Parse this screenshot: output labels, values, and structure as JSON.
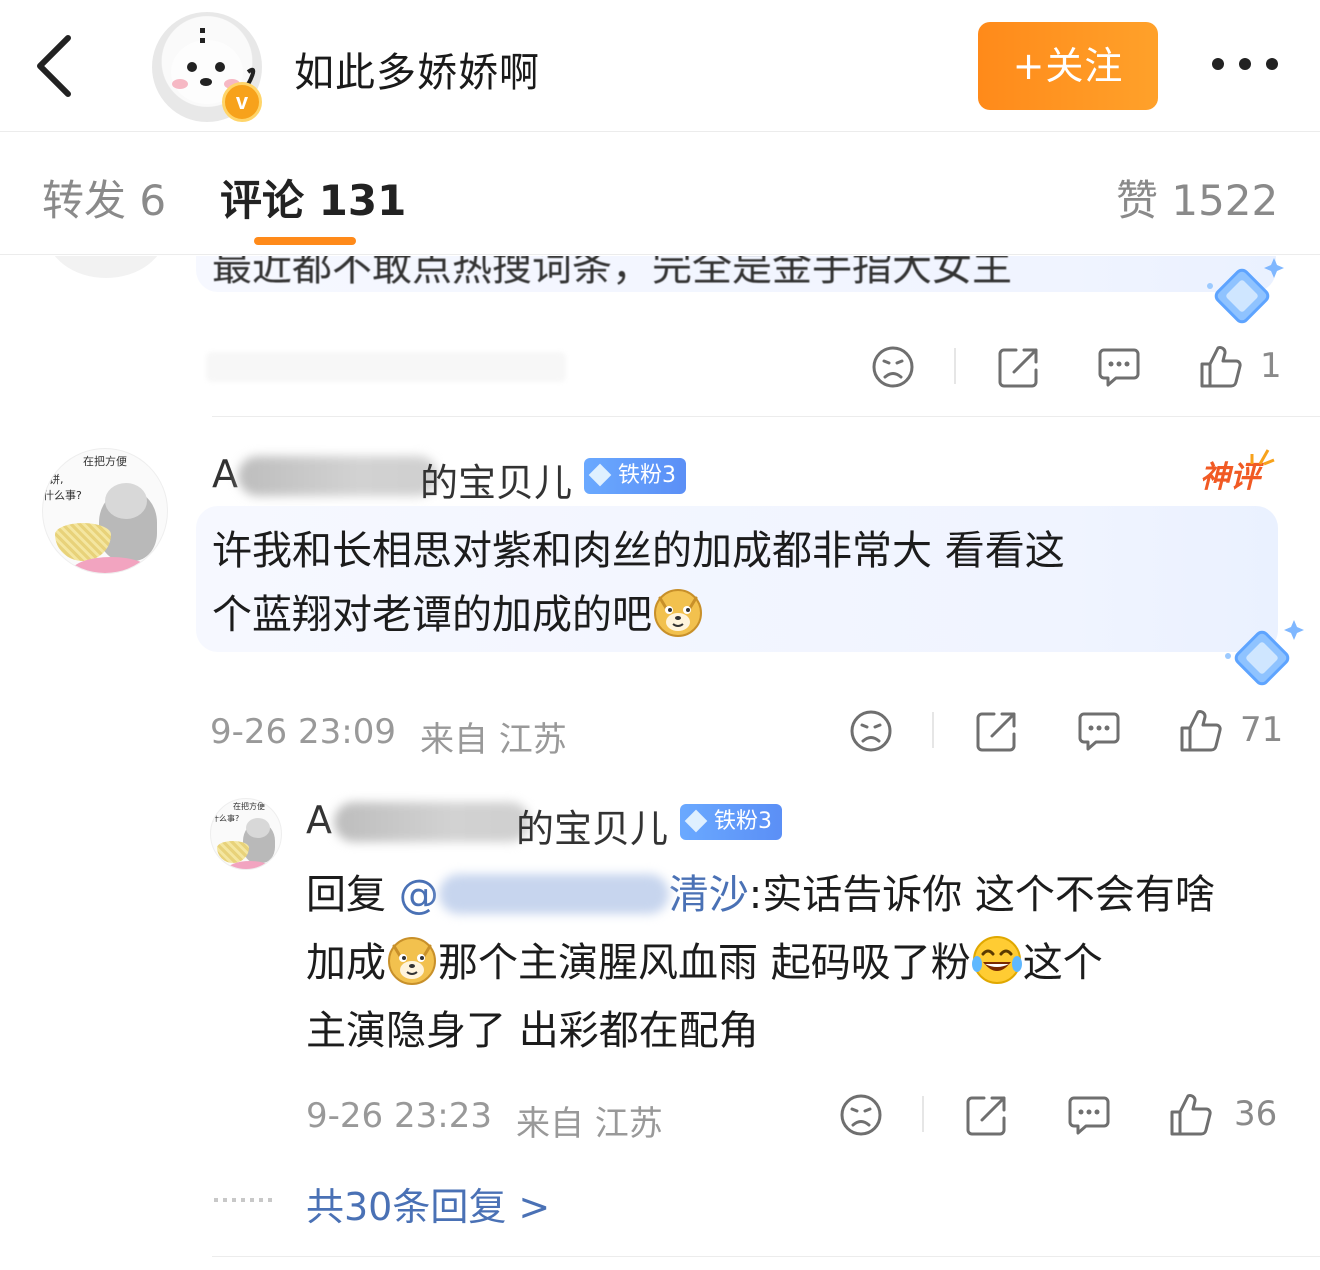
{
  "header": {
    "title": "如此多娇娇啊",
    "verified_badge": "v",
    "follow_label": "+关注"
  },
  "tabs": {
    "repost": "转发 6",
    "comments": "评论 131",
    "likes": "赞 1522"
  },
  "previous_comment": {
    "text_partial": "最近都不敢点热搜词条，完全是金手指大女主",
    "like_count": "1"
  },
  "comment": {
    "username_visible_start": "A",
    "username_visible_end": "的宝贝儿",
    "fan_badge": "铁粉3",
    "god_label": "神评",
    "text_line1": "许我和长相思对紫和肉丝的加成都非常大  看看这",
    "text_line2": "个蓝翔对老谭的加成的吧",
    "timestamp": "9-26 23:09",
    "location": "来自 江苏",
    "like_count": "71",
    "avatar_text_top": "在把方便",
    "avatar_text_left1": "饼,",
    "avatar_text_left2": "什么事?"
  },
  "reply": {
    "username_visible_start": "A",
    "username_visible_end": "的宝贝儿",
    "fan_badge": "铁粉3",
    "reply_prefix": "回复 ",
    "mention_start": "@",
    "mention_end": "清沙",
    "text_after_mention": ":实话告诉你 这个不会有啥",
    "line2_part1": "加成",
    "line2_part2": "那个主演腥风血雨 起码吸了粉",
    "line2_part3": "这个",
    "line3": "主演隐身了  出彩都在配角",
    "timestamp": "9-26 23:23",
    "location": "来自 江苏",
    "like_count": "36",
    "avatar_text_top": "在把方便",
    "avatar_text_left": "什么事?"
  },
  "more_replies": "共30条回复 >",
  "icons": [
    "back-icon",
    "more-icon",
    "dislike-icon",
    "share-icon",
    "comment-icon",
    "like-icon",
    "doge-emoji",
    "laugh-cry-emoji",
    "diamond-decoration"
  ],
  "colors": {
    "accent_orange": "#ff8a1a",
    "link_blue": "#4a71b5",
    "fan_badge_blue": "#5b8ff6",
    "god_comment_red": "#f15a24"
  }
}
